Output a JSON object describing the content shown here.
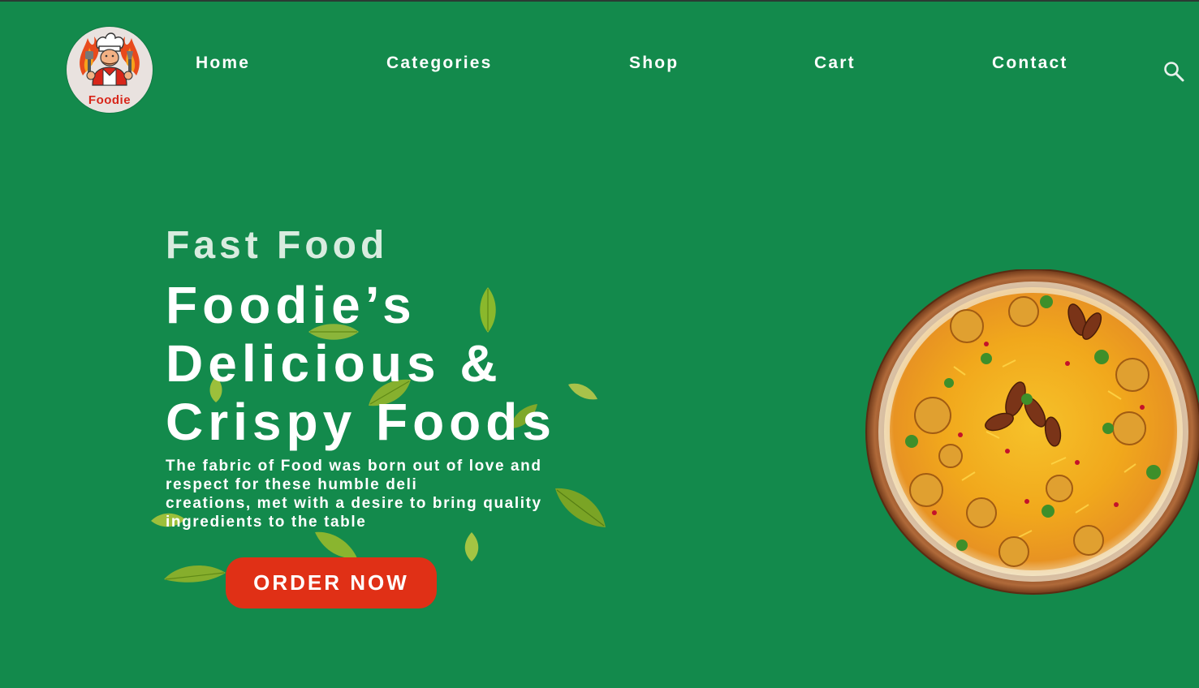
{
  "brand": {
    "logo_text": "Foodie"
  },
  "nav": {
    "items": [
      {
        "label": "Home"
      },
      {
        "label": "Categories"
      },
      {
        "label": "Shop"
      },
      {
        "label": "Cart"
      },
      {
        "label": "Contact"
      }
    ],
    "search_icon": "search-icon"
  },
  "hero": {
    "subtitle": "Fast Food",
    "headline_lines": [
      "Foodie’s",
      "Delicious &",
      "Crispy Foods"
    ],
    "description_lines": [
      "The fabric of Food was born out of love and",
      "respect for these humble deli",
      "creations, met with a desire to bring quality",
      "ingredients to the table"
    ],
    "cta_label": "ORDER NOW"
  },
  "colors": {
    "background": "#138a4c",
    "cta": "#e03016",
    "text": "#ffffff",
    "subtitle": "#d8ecdf",
    "logo_red": "#d8261a"
  }
}
